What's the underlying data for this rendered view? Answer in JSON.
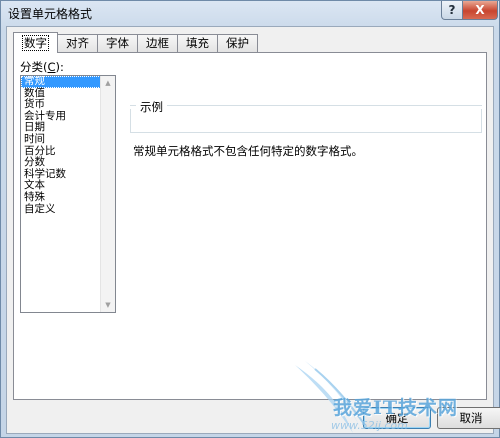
{
  "window": {
    "title": "设置单元格格式",
    "help_label": "?",
    "close_label": "X"
  },
  "tabs": [
    {
      "label": "数字",
      "active": true
    },
    {
      "label": "对齐",
      "active": false
    },
    {
      "label": "字体",
      "active": false
    },
    {
      "label": "边框",
      "active": false
    },
    {
      "label": "填充",
      "active": false
    },
    {
      "label": "保护",
      "active": false
    }
  ],
  "category": {
    "label": "分类(",
    "hotkey": "C",
    "label_suffix": "):",
    "items": [
      "常规",
      "数值",
      "货币",
      "会计专用",
      "日期",
      "时间",
      "百分比",
      "分数",
      "科学记数",
      "文本",
      "特殊",
      "自定义"
    ],
    "selected": "常规"
  },
  "sample": {
    "label": "示例",
    "value": ""
  },
  "description": "常规单元格格式不包含任何特定的数字格式。",
  "buttons": {
    "ok": "确定",
    "cancel": "取消"
  },
  "watermark": {
    "text": "我爱IT技术网",
    "url": "www.52ij.com"
  }
}
